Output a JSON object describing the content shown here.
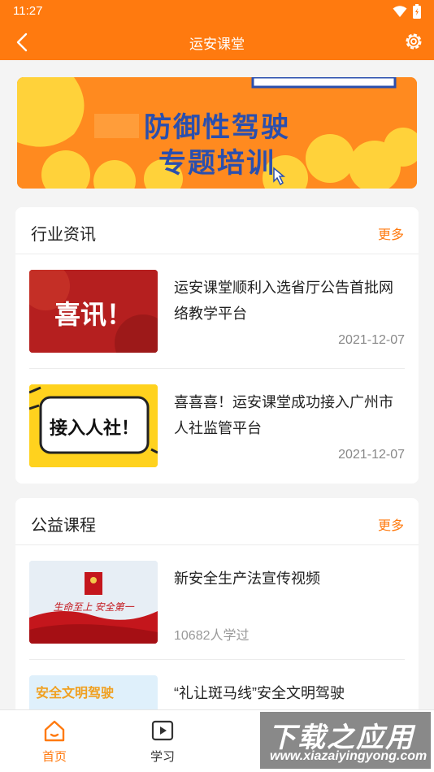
{
  "status": {
    "time": "11:27"
  },
  "header": {
    "title": "运安课堂"
  },
  "banner": {
    "line1": "防御性驾驶",
    "line2": "专题培训"
  },
  "news": {
    "title": "行业资讯",
    "more": "更多",
    "items": [
      {
        "thumb_text": "喜讯！",
        "title": "运安课堂顺利入选省厅公告首批网络教学平台",
        "date": "2021-12-07"
      },
      {
        "thumb_text": "接入人社！",
        "title": "喜喜喜！运安课堂成功接入广州市人社监管平台",
        "date": "2021-12-07"
      }
    ]
  },
  "courses": {
    "title": "公益课程",
    "more": "更多",
    "items": [
      {
        "thumb_text": "生命至上 安全第一",
        "title": "新安全生产法宣传视频",
        "learners": "10682人学过"
      },
      {
        "thumb_text": "安全文明驾驶",
        "title": "“礼让斑马线”安全文明驾驶",
        "learners": ""
      }
    ]
  },
  "tabbar": {
    "home": "首页",
    "study": "学习"
  },
  "watermark": {
    "line1": "下载之应用",
    "line2": "www.xiazaiyingyong.com"
  },
  "colors": {
    "accent": "#ff7a0f"
  }
}
